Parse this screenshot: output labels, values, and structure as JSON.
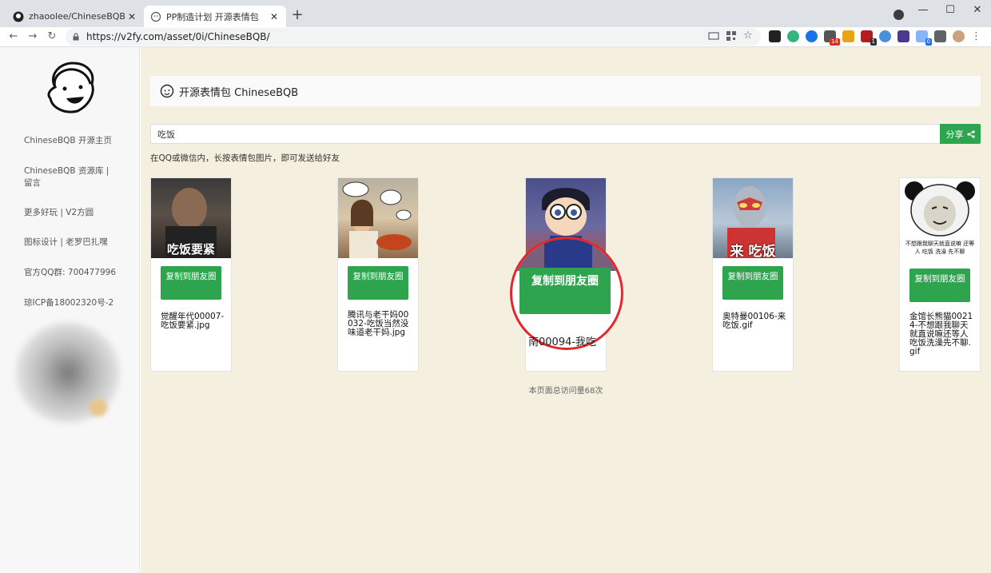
{
  "browser": {
    "tabs": [
      {
        "title": "zhaoolee/ChineseBQB: cn Chi"
      },
      {
        "title": "PP制造计划 开源表情包"
      }
    ],
    "url": "https://v2fy.com/asset/0i/ChineseBQB/",
    "extension_badges": [
      "14",
      "1",
      "0"
    ]
  },
  "sidebar": {
    "links": [
      {
        "label": "ChineseBQB 开源主页"
      },
      {
        "label": "ChineseBQB 资源库 | 留言"
      },
      {
        "label": "更多好玩 | V2方圆"
      },
      {
        "label": "图标设计 | 老罗巴扎嘿"
      },
      {
        "label": "官方QQ群: 700477996"
      },
      {
        "label": "琼ICP备18002320号-2"
      }
    ]
  },
  "header": {
    "title": "开源表情包 ChineseBQB"
  },
  "search": {
    "value": "吃饭",
    "share_label": "分享"
  },
  "hint": "在QQ或微信内，长按表情包图片，即可发送给好友",
  "cards": [
    {
      "caption": "吃饭要紧",
      "copy_label": "复制到朋友圈",
      "filename": "觉醒年代00007-吃饭要紧.jpg"
    },
    {
      "caption": "",
      "copy_label": "复制到朋友圈",
      "filename": "腾讯与老干妈00032-吃饭当然没味道老干妈.jpg"
    },
    {
      "caption": "",
      "copy_label": "复制到朋友圈",
      "filename": ""
    },
    {
      "caption": "来 吃饭",
      "copy_label": "复制到朋友圈",
      "filename": "奥特曼00106-来吃饭.gif"
    },
    {
      "caption": "不想跟我聊天就直说嘛 还等人 吃饭 洗澡 先不聊",
      "copy_label": "复制到朋友圈",
      "filename": "金馆长熊猫00214-不想跟我聊天就直说嘛还等人吃饭洗澡先不聊.gif"
    }
  ],
  "zoom": {
    "button_label": "复制到朋友圈",
    "partial_text": "南00094-我吃"
  },
  "footer": {
    "visit_count": "本页面总访问量68次"
  },
  "colors": {
    "accent_green": "#2ea44f",
    "page_bg": "#f5efe0",
    "ring_red": "#e0282e"
  }
}
